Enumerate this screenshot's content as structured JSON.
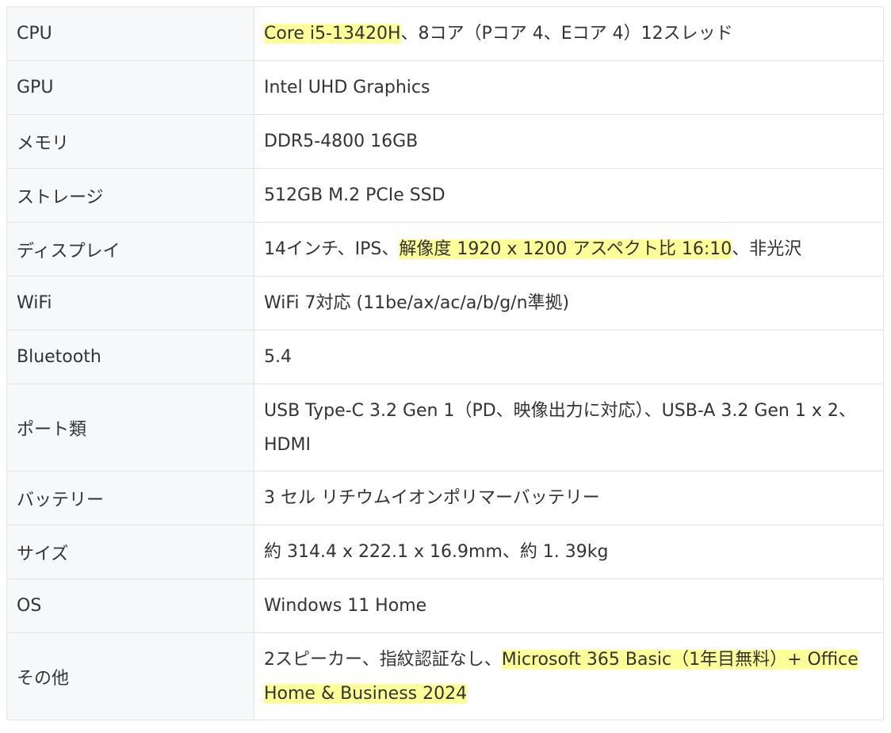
{
  "rows": [
    {
      "label": "CPU",
      "segments": [
        {
          "t": "Core i5-13420H",
          "hl": true
        },
        {
          "t": "、8コア（Pコア 4、Eコア 4）12スレッド",
          "hl": false
        }
      ]
    },
    {
      "label": "GPU",
      "segments": [
        {
          "t": "Intel UHD Graphics",
          "hl": false
        }
      ]
    },
    {
      "label": "メモリ",
      "segments": [
        {
          "t": "DDR5-4800 16GB",
          "hl": false
        }
      ]
    },
    {
      "label": "ストレージ",
      "segments": [
        {
          "t": "512GB M.2 PCIe SSD",
          "hl": false
        }
      ]
    },
    {
      "label": "ディスプレイ",
      "segments": [
        {
          "t": "14インチ、IPS、",
          "hl": false
        },
        {
          "t": "解像度 1920 x 1200 アスペクト比 16:10",
          "hl": true
        },
        {
          "t": "、非光沢",
          "hl": false
        }
      ]
    },
    {
      "label": "WiFi",
      "segments": [
        {
          "t": "WiFi 7対応 (11be/ax/ac/a/b/g/n準拠)",
          "hl": false
        }
      ]
    },
    {
      "label": "Bluetooth",
      "segments": [
        {
          "t": "5.4",
          "hl": false
        }
      ]
    },
    {
      "label": "ポート類",
      "segments": [
        {
          "t": "USB Type-C 3.2 Gen 1（PD、映像出力に対応）、USB-A 3.2 Gen 1 x 2、HDMI",
          "hl": false
        }
      ]
    },
    {
      "label": "バッテリー",
      "segments": [
        {
          "t": "3 セル リチウムイオンポリマーバッテリー",
          "hl": false
        }
      ]
    },
    {
      "label": "サイズ",
      "segments": [
        {
          "t": "約 314.4 x 222.1 x 16.9mm、約 1. 39kg",
          "hl": false
        }
      ]
    },
    {
      "label": "OS",
      "segments": [
        {
          "t": "Windows 11 Home",
          "hl": false
        }
      ]
    },
    {
      "label": "その他",
      "segments": [
        {
          "t": "2スピーカー、指紋認証なし、",
          "hl": false
        },
        {
          "t": "Microsoft 365 Basic（1年目無料）+ Office Home & Business 2024",
          "hl": true
        }
      ]
    }
  ]
}
